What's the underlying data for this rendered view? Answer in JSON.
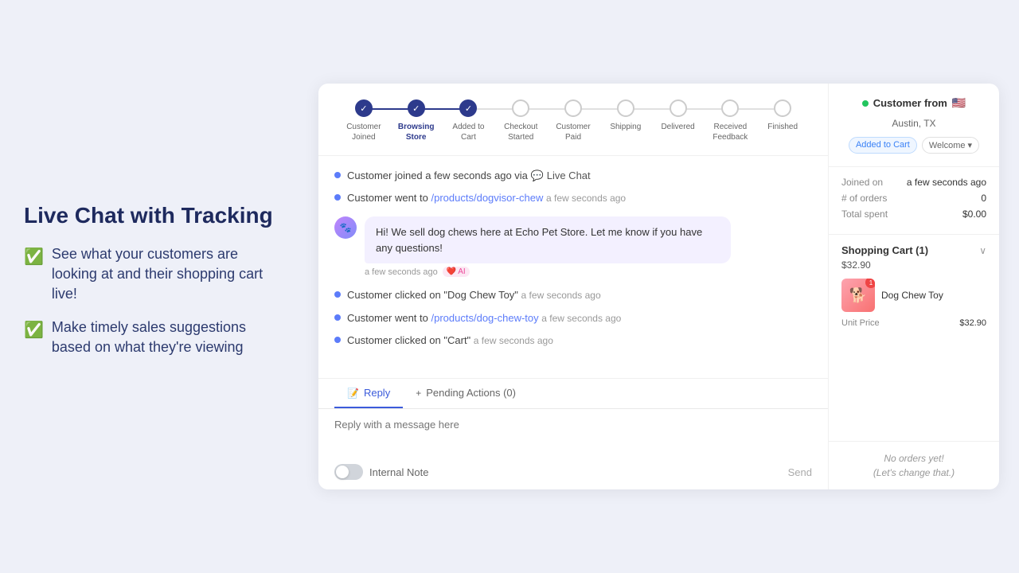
{
  "left": {
    "title": "Live Chat with Tracking",
    "features": [
      "See what your customers are looking at and their shopping cart live!",
      "Make timely sales suggestions based on what they're viewing"
    ]
  },
  "progress": {
    "steps": [
      {
        "label": "Customer\nJoined",
        "state": "completed"
      },
      {
        "label": "Browsing\nStore",
        "state": "completed"
      },
      {
        "label": "Added to\nCart",
        "state": "completed"
      },
      {
        "label": "Checkout\nStarted",
        "state": "inactive"
      },
      {
        "label": "Customer\nPaid",
        "state": "inactive"
      },
      {
        "label": "Shipping",
        "state": "inactive"
      },
      {
        "label": "Delivered",
        "state": "inactive"
      },
      {
        "label": "Received\nFeedback",
        "state": "inactive"
      },
      {
        "label": "Finished",
        "state": "inactive"
      }
    ]
  },
  "chat": {
    "activities": [
      {
        "text": "Customer joined a few seconds ago via",
        "link": null,
        "suffix": "Live Chat",
        "time": null,
        "type": "join"
      },
      {
        "text": "Customer went to",
        "link": "/products/dogvisor-chew",
        "suffix": null,
        "time": "a few seconds ago",
        "type": "navigate"
      },
      {
        "text": "Customer clicked on \"Dog Chew Toy\"",
        "link": null,
        "suffix": null,
        "time": "a few seconds ago",
        "type": "click"
      },
      {
        "text": "Customer went to",
        "link": "/products/dog-chew-toy",
        "suffix": null,
        "time": "a few seconds ago",
        "type": "navigate"
      },
      {
        "text": "Customer clicked on \"Cart\"",
        "link": null,
        "suffix": null,
        "time": "a few seconds ago",
        "type": "click"
      }
    ],
    "agent_message": {
      "text": "Hi! We sell dog chews here at Echo Pet Store. Let me know if you have any questions!",
      "time": "a few seconds ago",
      "ai": "AI"
    }
  },
  "tabs": {
    "reply_label": "Reply",
    "pending_label": "Pending Actions (0)"
  },
  "reply": {
    "placeholder": "Reply with a message here",
    "toggle_label": "Internal Note",
    "send_label": "Send"
  },
  "sidebar": {
    "customer_from": "Customer from",
    "flag": "🇺🇸",
    "city": "Austin, TX",
    "online": true,
    "tags": [
      "Added to Cart",
      "Welcome"
    ],
    "stats": [
      {
        "label": "Joined on",
        "value": "a few seconds ago"
      },
      {
        "label": "# of orders",
        "value": "0"
      },
      {
        "label": "Total spent",
        "value": "$0.00"
      }
    ],
    "cart": {
      "title": "Shopping Cart (1)",
      "total": "$32.90",
      "items": [
        {
          "name": "Dog Chew Toy",
          "unit_price_label": "Unit Price",
          "price": "$32.90",
          "quantity": 1,
          "emoji": "🐕"
        }
      ]
    },
    "orders": {
      "empty_line1": "No orders yet!",
      "empty_line2": "(Let's change that.)"
    }
  }
}
